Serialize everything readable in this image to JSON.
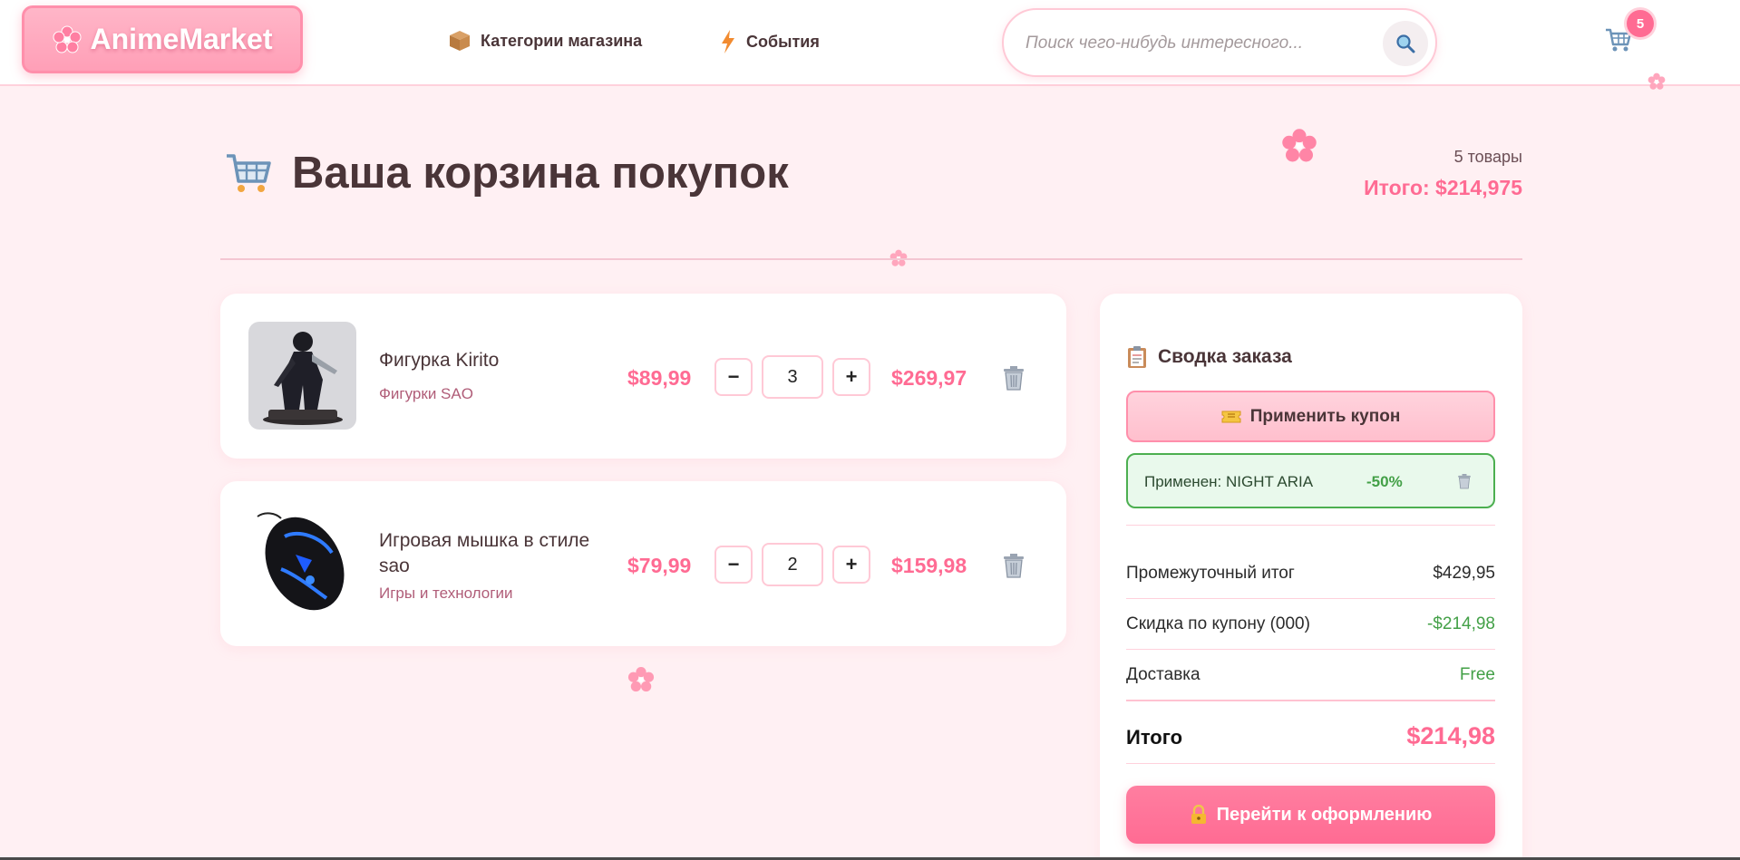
{
  "header": {
    "logo_text": "AnimeMarket",
    "nav": [
      {
        "label": "Категории магазина",
        "icon": "box-icon"
      },
      {
        "label": "События",
        "icon": "lightning-icon"
      }
    ],
    "search_placeholder": "Поиск чего-нибудь интересного...",
    "cart_count": "5"
  },
  "page": {
    "title": "Ваша корзина покупок",
    "items_count": "5 товары",
    "total_label": "Итого: $214,975"
  },
  "cart_items": [
    {
      "name": "Фигурка Kirito",
      "category": "Фигурки SAO",
      "price": "$89,99",
      "qty": "3",
      "total": "$269,97"
    },
    {
      "name": "Игровая мышка в стиле sao",
      "category": "Игры и технологии",
      "price": "$79,99",
      "qty": "2",
      "total": "$159,98"
    }
  ],
  "summary": {
    "title": "Сводка заказа",
    "coupon_button": "Применить купон",
    "coupon_applied_label": "Применен: NIGHT ARIA",
    "coupon_applied_pct": "-50%",
    "rows": [
      {
        "label": "Промежуточный итог",
        "value": "$429,95"
      },
      {
        "label": "Скидка по купону (000)",
        "value": "-$214,98"
      },
      {
        "label": "Доставка",
        "value": "Free"
      }
    ],
    "total_label": "Итого",
    "total_value": "$214,98",
    "checkout_button": "Перейти к оформлению"
  },
  "colors": {
    "accent": "#ff6b93",
    "page_bg": "#fff0f3",
    "success": "#43a047"
  }
}
